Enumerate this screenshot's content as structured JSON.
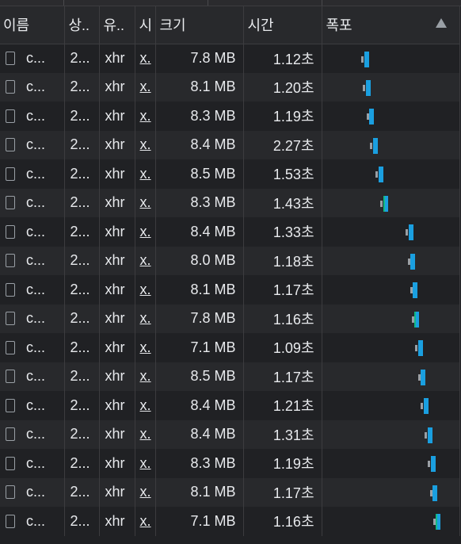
{
  "columns": {
    "name": "이름",
    "status": "상..",
    "type": "유..",
    "initiator": "시",
    "size": "크기",
    "time": "시간",
    "waterfall": "폭포"
  },
  "sort": {
    "column": "waterfall",
    "direction": "ascending",
    "icon": "sort-up-triangle-icon"
  },
  "colors": {
    "background": "#202124",
    "row_alt": "#28292c",
    "waterfall_download": "#1a9fe0",
    "waterfall_wait": "#9aa0a6",
    "waterfall_complete": "#12b886"
  },
  "rows": [
    {
      "name": "c...",
      "status": "2...",
      "type": "xhr",
      "initiator": "x.",
      "size": "7.8 MB",
      "time": "1.12초"
    },
    {
      "name": "c...",
      "status": "2...",
      "type": "xhr",
      "initiator": "x.",
      "size": "8.1 MB",
      "time": "1.20초"
    },
    {
      "name": "c...",
      "status": "2...",
      "type": "xhr",
      "initiator": "x.",
      "size": "8.3 MB",
      "time": "1.19초"
    },
    {
      "name": "c...",
      "status": "2...",
      "type": "xhr",
      "initiator": "x.",
      "size": "8.4 MB",
      "time": "2.27초"
    },
    {
      "name": "c...",
      "status": "2...",
      "type": "xhr",
      "initiator": "x.",
      "size": "8.5 MB",
      "time": "1.53초"
    },
    {
      "name": "c...",
      "status": "2...",
      "type": "xhr",
      "initiator": "x.",
      "size": "8.3 MB",
      "time": "1.43초"
    },
    {
      "name": "c...",
      "status": "2...",
      "type": "xhr",
      "initiator": "x.",
      "size": "8.4 MB",
      "time": "1.33초"
    },
    {
      "name": "c...",
      "status": "2...",
      "type": "xhr",
      "initiator": "x.",
      "size": "8.0 MB",
      "time": "1.18초"
    },
    {
      "name": "c...",
      "status": "2...",
      "type": "xhr",
      "initiator": "x.",
      "size": "8.1 MB",
      "time": "1.17초"
    },
    {
      "name": "c...",
      "status": "2...",
      "type": "xhr",
      "initiator": "x.",
      "size": "7.8 MB",
      "time": "1.16초"
    },
    {
      "name": "c...",
      "status": "2...",
      "type": "xhr",
      "initiator": "x.",
      "size": "7.1 MB",
      "time": "1.09초"
    },
    {
      "name": "c...",
      "status": "2...",
      "type": "xhr",
      "initiator": "x.",
      "size": "8.5 MB",
      "time": "1.17초"
    },
    {
      "name": "c...",
      "status": "2...",
      "type": "xhr",
      "initiator": "x.",
      "size": "8.4 MB",
      "time": "1.21초"
    },
    {
      "name": "c...",
      "status": "2...",
      "type": "xhr",
      "initiator": "x.",
      "size": "8.4 MB",
      "time": "1.31초"
    },
    {
      "name": "c...",
      "status": "2...",
      "type": "xhr",
      "initiator": "x.",
      "size": "8.3 MB",
      "time": "1.19초"
    },
    {
      "name": "c...",
      "status": "2...",
      "type": "xhr",
      "initiator": "x.",
      "size": "8.1 MB",
      "time": "1.17초"
    },
    {
      "name": "c...",
      "status": "2...",
      "type": "xhr",
      "initiator": "x.",
      "size": "7.1 MB",
      "time": "1.16초"
    }
  ]
}
